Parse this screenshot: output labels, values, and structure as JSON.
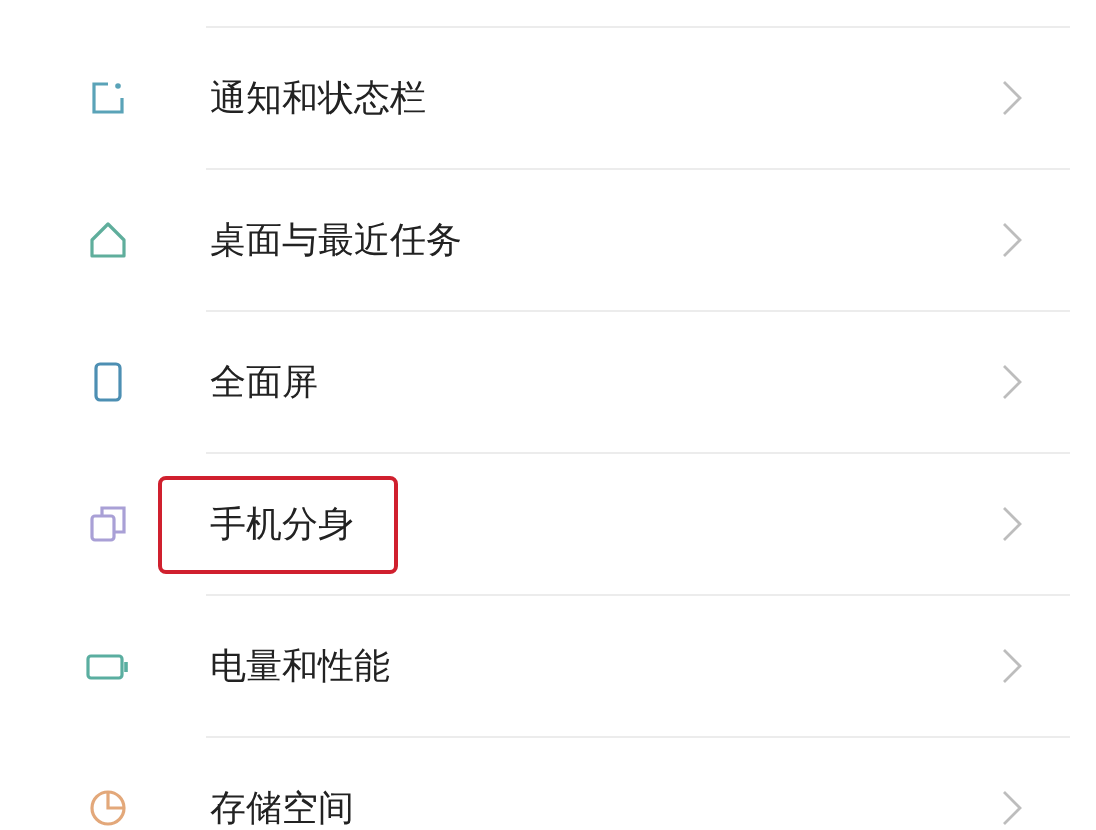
{
  "settings_items": [
    {
      "label": "通知和状态栏",
      "highlighted": false
    },
    {
      "label": "桌面与最近任务",
      "highlighted": false
    },
    {
      "label": "全面屏",
      "highlighted": false
    },
    {
      "label": "手机分身",
      "highlighted": true
    },
    {
      "label": "电量和性能",
      "highlighted": false
    },
    {
      "label": "存储空间",
      "highlighted": false
    }
  ]
}
